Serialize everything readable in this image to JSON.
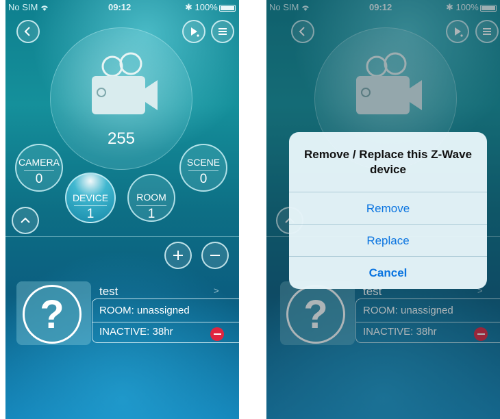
{
  "status_bar": {
    "carrier": "No SIM",
    "time": "09:12",
    "battery": "100%"
  },
  "hero": {
    "icon": "video-camera-icon",
    "value": "255"
  },
  "counters": {
    "camera": {
      "label": "CAMERA",
      "count": "0"
    },
    "scene": {
      "label": "SCENE",
      "count": "0"
    },
    "device": {
      "label": "DEVICE",
      "count": "1"
    },
    "room": {
      "label": "ROOM",
      "count": "1"
    }
  },
  "device": {
    "name": "test",
    "room": "ROOM: unassigned",
    "status": "INACTIVE: 38hr",
    "chevron": ">",
    "icon": "question-mark-icon"
  },
  "dialog": {
    "title": "Remove / Replace this Z-Wave device",
    "remove": "Remove",
    "replace": "Replace",
    "cancel": "Cancel"
  },
  "colors": {
    "accent": "#0a74e0",
    "danger": "#e0253f",
    "background_top": "#0e7f8e",
    "background_bottom": "#1383b8"
  }
}
